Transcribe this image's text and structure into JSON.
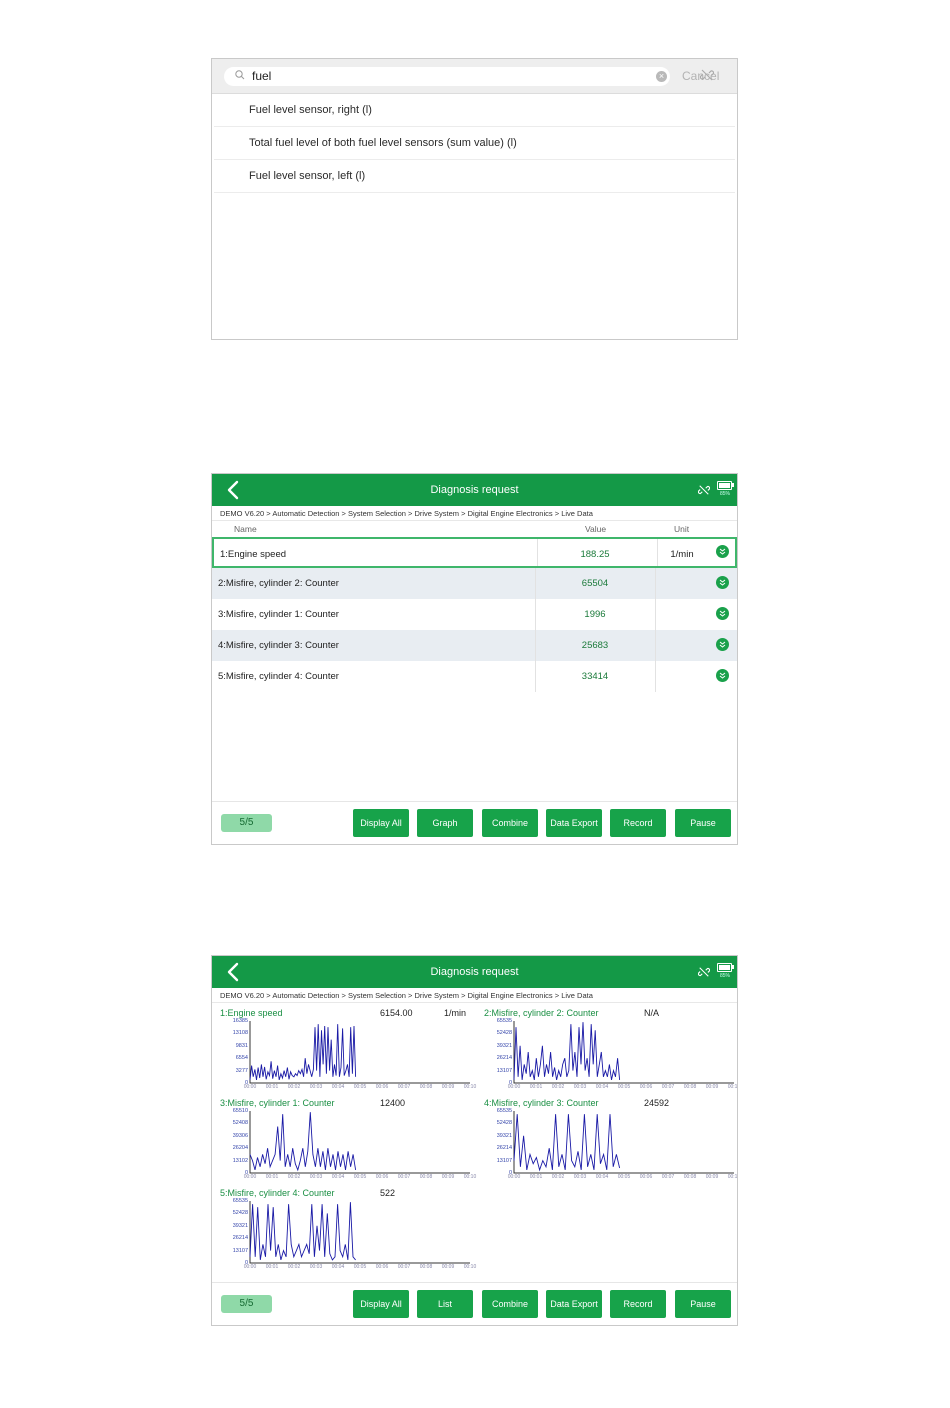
{
  "search": {
    "query": "fuel",
    "cancel_label": "Cancel",
    "results": [
      "Fuel level sensor, right (l)",
      "Total fuel level of both fuel level sensors (sum value) (l)",
      "Fuel level sensor, left (l)"
    ]
  },
  "header": {
    "title": "Diagnosis request",
    "battery": "85%"
  },
  "breadcrumb": "DEMO V6.20 > Automatic Detection  > System Selection  > Drive System  > Digital Engine Electronics  > Live Data",
  "table": {
    "columns": {
      "name": "Name",
      "value": "Value",
      "unit": "Unit"
    },
    "rows": [
      {
        "name": "1:Engine speed",
        "value": "188.25",
        "unit": "1/min"
      },
      {
        "name": "2:Misfire, cylinder 2: Counter",
        "value": "65504",
        "unit": ""
      },
      {
        "name": "3:Misfire, cylinder 1: Counter",
        "value": "1996",
        "unit": ""
      },
      {
        "name": "4:Misfire, cylinder 3: Counter",
        "value": "25683",
        "unit": ""
      },
      {
        "name": "5:Misfire, cylinder 4: Counter",
        "value": "33414",
        "unit": ""
      }
    ]
  },
  "footer_table": {
    "counter": "5/5",
    "buttons": [
      "Display All",
      "Graph",
      "Combine",
      "Data Export",
      "Record",
      "Pause"
    ]
  },
  "graphs": [
    {
      "title": "1:Engine speed",
      "value": "6154.00",
      "unit": "1/min",
      "yticks": [
        "16385",
        "13108",
        "9831",
        "6554",
        "3277",
        "0"
      ],
      "xticks": [
        "00:00",
        "00:01",
        "00:02",
        "00:03",
        "00:04",
        "00:05",
        "00:06",
        "00:07",
        "00:08",
        "00:09",
        "00:10"
      ],
      "values": [
        0.05,
        0.28,
        0.1,
        0.22,
        0.05,
        0.25,
        0.08,
        0.3,
        0.1,
        0.26,
        0.06,
        0.18,
        0.12,
        0.35,
        0.07,
        0.2,
        0.1,
        0.28,
        0.05,
        0.15,
        0.08,
        0.2,
        0.1,
        0.25,
        0.06,
        0.18,
        0.12,
        0.1,
        0.15,
        0.12,
        0.2,
        0.15,
        0.22,
        0.1,
        0.4,
        0.15,
        0.3,
        0.2,
        0.1,
        0.22,
        0.9,
        0.2,
        0.95,
        0.1,
        0.85,
        0.3,
        0.92,
        0.15,
        0.9,
        0.2,
        0.7,
        0.1,
        0.3,
        0.12,
        0.95,
        0.1,
        0.25,
        0.88,
        0.12,
        0.2,
        0.3,
        0.1,
        0.9,
        0.15,
        0.92,
        0.1
      ]
    },
    {
      "title": "2:Misfire, cylinder 2: Counter",
      "value": "N/A",
      "unit": "",
      "yticks": [
        "65535",
        "52428",
        "39321",
        "26214",
        "13107",
        "0"
      ],
      "xticks": [
        "00:00",
        "00:01",
        "00:02",
        "00:03",
        "00:04",
        "00:05",
        "00:06",
        "00:07",
        "00:08",
        "00:09",
        "00:10"
      ],
      "values": [
        0.05,
        0.9,
        0.1,
        0.6,
        0.05,
        0.3,
        0.15,
        0.5,
        0.1,
        0.2,
        0.05,
        0.4,
        0.1,
        0.3,
        0.6,
        0.1,
        0.3,
        0.15,
        0.5,
        0.1,
        0.25,
        0.05,
        0.2,
        0.1,
        0.3,
        0.4,
        0.1,
        0.2,
        0.95,
        0.2,
        0.5,
        0.1,
        0.9,
        0.3,
        0.98,
        0.2,
        0.4,
        0.1,
        0.95,
        0.3,
        0.85,
        0.1,
        0.3,
        0.5,
        0.1,
        0.2,
        0.1,
        0.3,
        0.05,
        0.2,
        0.1,
        0.4,
        0.05
      ]
    },
    {
      "title": "3:Misfire, cylinder 1: Counter",
      "value": "12400",
      "unit": "",
      "yticks": [
        "65510",
        "52408",
        "39306",
        "26204",
        "13102",
        "0"
      ],
      "xticks": [
        "00:00",
        "00:01",
        "00:02",
        "00:03",
        "00:04",
        "00:05",
        "00:06",
        "00:07",
        "00:08",
        "00:09",
        "00:10"
      ],
      "values": [
        0.3,
        0.2,
        0.05,
        0.25,
        0.1,
        0.3,
        0.15,
        0.4,
        0.1,
        0.2,
        0.3,
        0.75,
        0.2,
        0.95,
        0.1,
        0.3,
        0.1,
        0.4,
        0.15,
        0.05,
        0.2,
        0.4,
        0.1,
        0.35,
        0.98,
        0.3,
        0.1,
        0.4,
        0.1,
        0.35,
        0.05,
        0.4,
        0.1,
        0.3,
        0.05,
        0.35,
        0.1,
        0.3,
        0.05,
        0.35,
        0.1,
        0.3,
        0.05
      ]
    },
    {
      "title": "4:Misfire, cylinder 3: Counter",
      "value": "24592",
      "unit": "",
      "yticks": [
        "65535",
        "52428",
        "39321",
        "26214",
        "13107",
        "0"
      ],
      "xticks": [
        "00:00",
        "00:01",
        "00:02",
        "00:03",
        "00:04",
        "00:05",
        "00:06",
        "00:07",
        "00:08",
        "00:09",
        "00:10"
      ],
      "values": [
        0.2,
        0.95,
        0.1,
        0.6,
        0.05,
        0.3,
        0.15,
        0.25,
        0.05,
        0.2,
        0.1,
        0.4,
        0.05,
        0.95,
        0.1,
        0.3,
        0.05,
        0.95,
        0.2,
        0.1,
        0.35,
        0.05,
        0.95,
        0.1,
        0.3,
        0.05,
        0.95,
        0.15,
        0.3,
        0.05,
        0.95,
        0.1,
        0.3,
        0.08
      ]
    },
    {
      "title": "5:Misfire, cylinder 4: Counter",
      "value": "522",
      "unit": "",
      "yticks": [
        "65535",
        "52428",
        "39321",
        "26214",
        "13107",
        "0"
      ],
      "xticks": [
        "00:00",
        "00:01",
        "00:02",
        "00:03",
        "00:04",
        "00:05",
        "00:06",
        "00:07",
        "00:08",
        "00:09",
        "00:10"
      ],
      "values": [
        0.1,
        0.95,
        0.1,
        0.9,
        0.05,
        0.3,
        0.1,
        0.95,
        0.2,
        0.9,
        0.1,
        0.3,
        0.05,
        0.2,
        0.1,
        0.95,
        0.3,
        0.1,
        0.2,
        0.3,
        0.1,
        0.2,
        0.3,
        0.15,
        0.95,
        0.1,
        0.6,
        0.2,
        0.95,
        0.1,
        0.8,
        0.15,
        0.05,
        0.1,
        0.95,
        0.2,
        0.1,
        0.3,
        0.05,
        0.98,
        0.1,
        0.05
      ]
    }
  ],
  "footer_graph": {
    "counter": "5/5",
    "buttons": [
      "Display All",
      "List",
      "Combine",
      "Data Export",
      "Record",
      "Pause"
    ]
  },
  "colors": {
    "accent": "#149947",
    "plot_line": "#1a1aa6",
    "value_text": "#1a7a3a"
  }
}
